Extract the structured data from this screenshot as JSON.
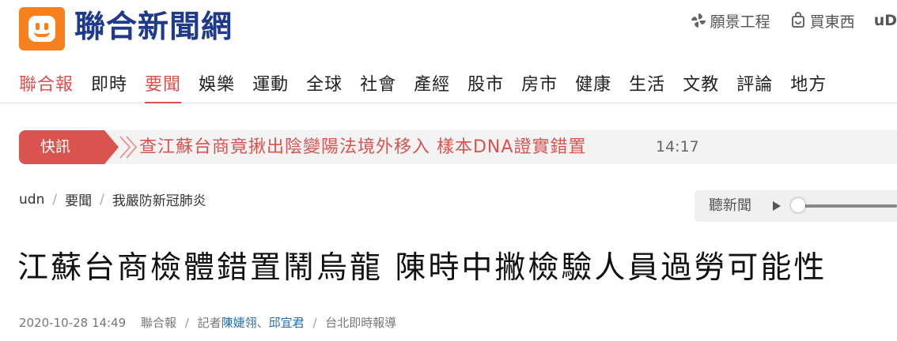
{
  "header": {
    "site_name": "聯合新聞網",
    "top_links": [
      {
        "label": "願景工程",
        "icon": "pinwheel-icon"
      },
      {
        "label": "買東西",
        "icon": "shopping-bag-icon"
      }
    ],
    "account_text": "uD"
  },
  "nav": {
    "items": [
      "聯合報",
      "即時",
      "要聞",
      "娛樂",
      "運動",
      "全球",
      "社會",
      "產經",
      "股市",
      "房市",
      "健康",
      "生活",
      "文教",
      "評論",
      "地方"
    ],
    "active_index": 2,
    "brand_index": 0
  },
  "flash": {
    "label": "快訊",
    "text": "查江蘇台商竟揪出陰變陽法境外移入 樣本DNA證實錯置",
    "time": "14:17"
  },
  "breadcrumb": [
    "udn",
    "要聞",
    "我嚴防新冠肺炎"
  ],
  "listen": {
    "label": "聽新聞",
    "progress": 0
  },
  "article": {
    "headline": "江蘇台商檢體錯置鬧烏龍 陳時中撇檢驗人員過勞可能性",
    "datetime": "2020-10-28 14:49",
    "source": "聯合報",
    "reporter_prefix": "記者",
    "reporters": [
      "陳婕翎",
      "邱宜君"
    ],
    "reporter_joiner": "、",
    "location": "台北即時報導"
  },
  "colors": {
    "brand_orange": "#f5821f",
    "brand_blue": "#1f3a8a",
    "accent_red": "#d9534f",
    "link_blue": "#1f6fb5"
  }
}
